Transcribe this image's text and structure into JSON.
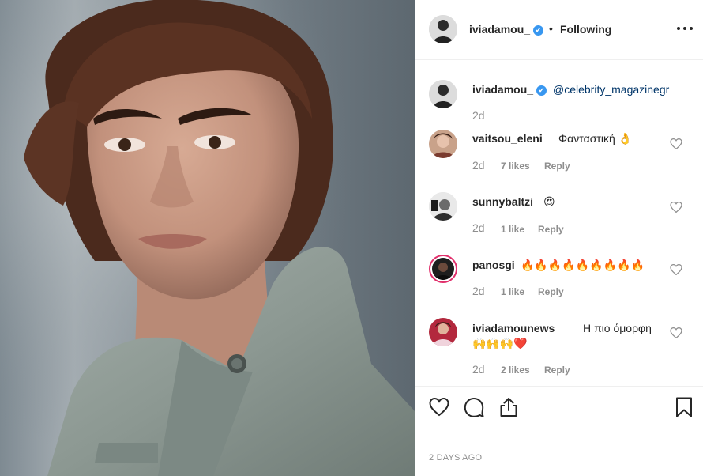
{
  "post": {
    "username": "iviadamou_",
    "verified_mark": "✔",
    "separator": "•",
    "follow_status": "Following",
    "more_icon": "more-horizontal-icon"
  },
  "caption": {
    "username": "iviadamou_",
    "mention": "@celebrity_magazinegr",
    "time": "2d"
  },
  "comments": [
    {
      "username": "vaitsou_eleni",
      "text": "Φανταστική 👌",
      "time": "2d",
      "likes": "7 likes",
      "reply": "Reply"
    },
    {
      "username": "sunnybaltzi",
      "text": "😍",
      "time": "2d",
      "likes": "1 like",
      "reply": "Reply"
    },
    {
      "username": "panosgi",
      "text": "🔥🔥🔥🔥🔥🔥🔥🔥🔥",
      "time": "2d",
      "likes": "1 like",
      "reply": "Reply"
    },
    {
      "username": "iviadamounews",
      "text": "Η πιο όμορφη",
      "text2": "🙌🙌🙌❤️",
      "time": "2d",
      "likes": "2 likes",
      "reply": "Reply"
    }
  ],
  "actions": {
    "like_icon": "heart-icon",
    "comment_icon": "comment-icon",
    "share_icon": "share-icon",
    "save_icon": "bookmark-icon"
  },
  "timestamp": "2 DAYS AGO",
  "colors": {
    "verified": "#3897f0",
    "mention": "#003569",
    "muted": "#8e8e8e",
    "story_ring": "#e1306c"
  }
}
